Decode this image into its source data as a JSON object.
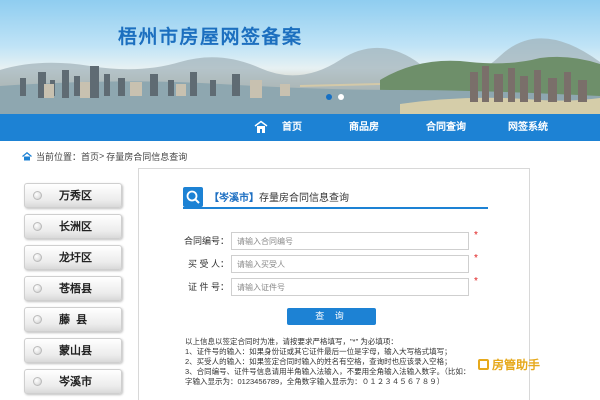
{
  "banner": {
    "title": "梧州市房屋网签备案",
    "slides": 2,
    "active_slide": 2
  },
  "nav": {
    "items": [
      {
        "label": "首页",
        "icon": "home-icon"
      },
      {
        "label": "商品房"
      },
      {
        "label": "合同查询"
      },
      {
        "label": "网签系统"
      }
    ]
  },
  "breadcrumb": {
    "prefix": "当前位置：",
    "home": "首页",
    "separator": ">",
    "current": "存量房合同信息查询"
  },
  "sidebar": {
    "items": [
      {
        "label": "万秀区"
      },
      {
        "label": "长洲区"
      },
      {
        "label": "龙圩区"
      },
      {
        "label": "苍梧县"
      },
      {
        "label": "藤  县"
      },
      {
        "label": "蒙山县"
      },
      {
        "label": "岑溪市"
      }
    ]
  },
  "panel": {
    "city": "【岑溪市】",
    "title": "存量房合同信息查询",
    "fields": [
      {
        "label": "合同编号：",
        "placeholder": "请输入合同编号",
        "required": "*"
      },
      {
        "label": "买 受 人：",
        "placeholder": "请输入买受人",
        "required": "*"
      },
      {
        "label": "证 件 号：",
        "placeholder": "请输入证件号",
        "required": "*"
      }
    ],
    "query_label": "查 询",
    "notes": [
      "以上信息以签定合同时为准，请按要求严格填写，\"*\" 为必填项：",
      "1、证件号的输入：如果身份证或其它证件最后一位是字母，输入大写格式填写；",
      "2、买受人的输入：如果签定合同时输入的姓名有空格，查询时也应该录入空格；",
      "3、合同编号、证件号信息请用半角输入法输入，不要用全角输入法输入数字。（比如：",
      "字输入显示为：0123456789，全角数字输入显示为：０１２３４５６７８９）"
    ]
  },
  "watermark": {
    "text": "房管助手"
  },
  "colors": {
    "primary": "#1d82d4",
    "title_blue": "#1c6fbf",
    "required_red": "#e02020",
    "watermark_orange": "#e6a91c"
  }
}
